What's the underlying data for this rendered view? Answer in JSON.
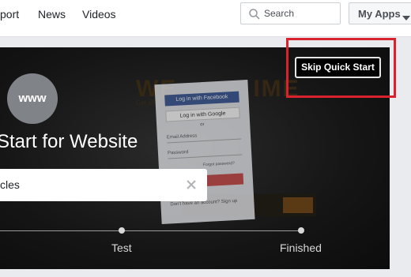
{
  "topnav": {
    "support": "port",
    "news": "News",
    "videos": "Videos"
  },
  "search": {
    "placeholder": "Search"
  },
  "myapps": {
    "label": "My Apps"
  },
  "hero": {
    "avatar_text": "www",
    "title": "Start for Website",
    "input_value": "cles",
    "skip_label": "Skip Quick Start",
    "steps": [
      "Test",
      "Finished"
    ]
  },
  "background_screenshot": {
    "title": "WE",
    "title_suffix": "IME",
    "subtitle": "Get all",
    "facebook_button": "Log in with Facebook",
    "google_button": "Log in with Google",
    "or": "or",
    "email_placeholder": "Email Address",
    "password_placeholder": "Password",
    "forgot": "Forgot password?",
    "no_account": "Don't have an account? Sign up"
  },
  "colors": {
    "highlight": "#d8232f",
    "facebook_blue": "#3b5998",
    "page_bg": "#e9ebee"
  }
}
